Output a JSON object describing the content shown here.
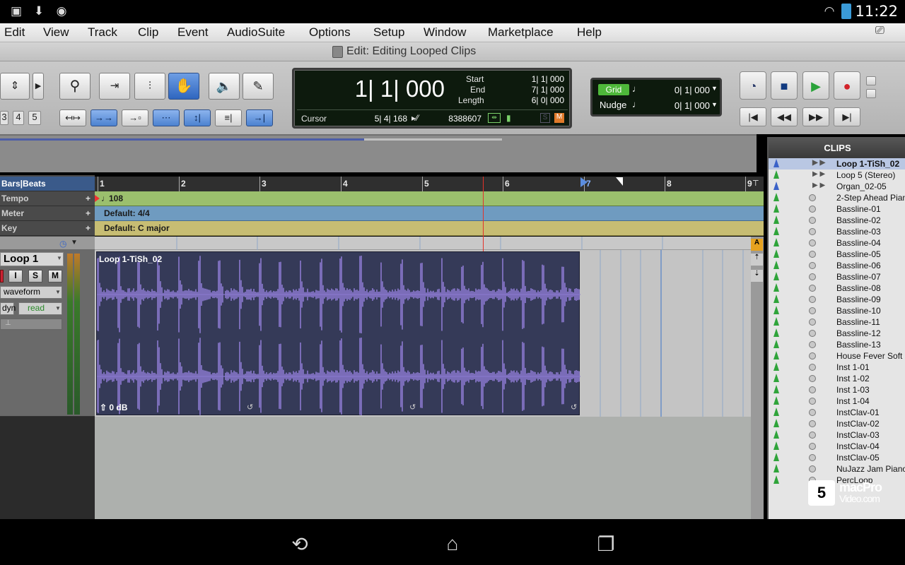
{
  "status": {
    "time": "11:22"
  },
  "menu": [
    "Edit",
    "View",
    "Track",
    "Clip",
    "Event",
    "AudioSuite",
    "Options",
    "Setup",
    "Window",
    "Marketplace",
    "Help"
  ],
  "window_title": "Edit: Editing Looped Clips",
  "toolbar": {
    "zoom_presets": [
      "3",
      "4",
      "5"
    ]
  },
  "counter": {
    "main": "1| 1| 000",
    "start_label": "Start",
    "start": "1| 1| 000",
    "end_label": "End",
    "end": "7| 1| 000",
    "length_label": "Length",
    "length": "6| 0| 000",
    "cursor_label": "Cursor",
    "cursor": "5| 4| 168",
    "samples": "8388607",
    "s_btn": "S",
    "m_btn": "M"
  },
  "grid": {
    "grid_label": "Grid",
    "grid_value": "0| 1| 000",
    "nudge_label": "Nudge",
    "nudge_value": "0| 1| 000"
  },
  "rulers": {
    "bars_beats": "Bars|Beats",
    "tempo": "Tempo",
    "tempo_value": "108",
    "meter": "Meter",
    "meter_value": "Default: 4/4",
    "key": "Key",
    "key_value": "Default: C major",
    "bar_numbers": [
      "1",
      "2",
      "3",
      "4",
      "5",
      "6",
      "7",
      "8",
      "9"
    ]
  },
  "track": {
    "name": "Loop 1",
    "rec_btn": "",
    "i_btn": "I",
    "s_btn": "S",
    "m_btn": "M",
    "view": "waveform",
    "dyn": "dyn",
    "automation": "read"
  },
  "clip": {
    "name": "Loop 1-TiSh_02",
    "gain": "0 dB",
    "color": "#8b7ad0"
  },
  "clips_panel": {
    "title": "CLIPS",
    "items": [
      {
        "name": "Loop 1-TiSh_02",
        "type": "loop"
      },
      {
        "name": "Loop 5 (Stereo)",
        "type": "loop"
      },
      {
        "name": "Organ_02-05",
        "type": "loop"
      },
      {
        "name": "2-Step Ahead Piano",
        "type": "audio"
      },
      {
        "name": "Bassline-01",
        "type": "audio"
      },
      {
        "name": "Bassline-02",
        "type": "audio"
      },
      {
        "name": "Bassline-03",
        "type": "audio"
      },
      {
        "name": "Bassline-04",
        "type": "audio"
      },
      {
        "name": "Bassline-05",
        "type": "audio"
      },
      {
        "name": "Bassline-06",
        "type": "audio"
      },
      {
        "name": "Bassline-07",
        "type": "audio"
      },
      {
        "name": "Bassline-08",
        "type": "audio"
      },
      {
        "name": "Bassline-09",
        "type": "audio"
      },
      {
        "name": "Bassline-10",
        "type": "audio"
      },
      {
        "name": "Bassline-11",
        "type": "audio"
      },
      {
        "name": "Bassline-12",
        "type": "audio"
      },
      {
        "name": "Bassline-13",
        "type": "audio"
      },
      {
        "name": "House Fever Soft",
        "type": "audio"
      },
      {
        "name": "Inst 1-01",
        "type": "audio"
      },
      {
        "name": "Inst 1-02",
        "type": "audio"
      },
      {
        "name": "Inst 1-03",
        "type": "audio"
      },
      {
        "name": "Inst 1-04",
        "type": "audio"
      },
      {
        "name": "InstClav-01",
        "type": "audio"
      },
      {
        "name": "InstClav-02",
        "type": "audio"
      },
      {
        "name": "InstClav-03",
        "type": "audio"
      },
      {
        "name": "InstClav-04",
        "type": "audio"
      },
      {
        "name": "InstClav-05",
        "type": "audio"
      },
      {
        "name": "NuJazz Jam Piano",
        "type": "audio"
      },
      {
        "name": "PercLoop",
        "type": "audio"
      }
    ]
  },
  "watermark": {
    "line1": "macPro",
    "line2": "Video.com"
  }
}
